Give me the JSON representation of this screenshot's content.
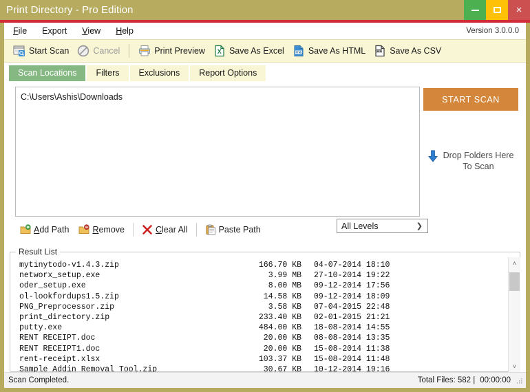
{
  "window": {
    "title": "Print Directory - Pro Edition",
    "buttons": {
      "minimize": "minimize-button",
      "maximize": "maximize-button",
      "close": "×"
    }
  },
  "menubar": {
    "items": [
      {
        "label": "File",
        "accel": "F"
      },
      {
        "label": "Export",
        "accel": ""
      },
      {
        "label": "View",
        "accel": "V"
      },
      {
        "label": "Help",
        "accel": "H"
      }
    ],
    "version": "Version 3.0.0.0"
  },
  "toolbar": {
    "buttons": [
      {
        "label": "Start Scan",
        "icon": "scan-window-icon",
        "disabled": false
      },
      {
        "label": "Cancel",
        "icon": "cancel-icon",
        "disabled": true
      },
      {
        "label": "Print Preview",
        "icon": "printer-icon",
        "disabled": false
      },
      {
        "label": "Save As Excel",
        "icon": "excel-file-icon",
        "disabled": false
      },
      {
        "label": "Save As HTML",
        "icon": "html-file-icon",
        "disabled": false
      },
      {
        "label": "Save As CSV",
        "icon": "csv-file-icon",
        "disabled": false
      }
    ]
  },
  "tabs": [
    {
      "label": "Scan Locations",
      "active": true
    },
    {
      "label": "Filters",
      "active": false
    },
    {
      "label": "Exclusions",
      "active": false
    },
    {
      "label": "Report Options",
      "active": false
    }
  ],
  "scan_locations": {
    "paths": [
      "C:\\Users\\Ashis\\Downloads"
    ],
    "path_toolbar": [
      {
        "label": "Add Path",
        "accel": "A",
        "icon": "folder-add-icon"
      },
      {
        "label": "Remove",
        "accel": "R",
        "icon": "folder-remove-icon"
      },
      {
        "label": "Clear All",
        "accel": "C",
        "icon": "red-x-icon"
      },
      {
        "label": "Paste Path",
        "accel": "",
        "icon": "clipboard-icon"
      }
    ],
    "levels": {
      "selected": "All Levels",
      "options": [
        "All Levels"
      ]
    },
    "start_scan_button": "START SCAN",
    "drop_zone": {
      "icon": "download-arrow-icon",
      "line1": "Drop Folders Here",
      "line2": "To Scan"
    }
  },
  "result_list": {
    "group_label": "Result List",
    "rows": [
      {
        "name": "mytinytodo-v1.4.3.zip",
        "size": "166.70 KB",
        "date": "04-07-2014 18:10"
      },
      {
        "name": "networx_setup.exe",
        "size": "3.99 MB",
        "date": "27-10-2014 19:22"
      },
      {
        "name": "oder_setup.exe",
        "size": "8.00 MB",
        "date": "09-12-2014 17:56"
      },
      {
        "name": "ol-lookfordups1.5.zip",
        "size": "14.58 KB",
        "date": "09-12-2014 18:09"
      },
      {
        "name": "PNG_Preprocessor.zip",
        "size": "3.58 KB",
        "date": "07-04-2015 22:48"
      },
      {
        "name": "print_directory.zip",
        "size": "233.40 KB",
        "date": "02-01-2015 21:21"
      },
      {
        "name": "putty.exe",
        "size": "484.00 KB",
        "date": "18-08-2014 14:55"
      },
      {
        "name": "RENT RECEIPT.doc",
        "size": "20.00 KB",
        "date": "08-08-2014 13:35"
      },
      {
        "name": "RENT RECEIPT1.doc",
        "size": "20.00 KB",
        "date": "15-08-2014 11:38"
      },
      {
        "name": "rent-receipt.xlsx",
        "size": "103.37 KB",
        "date": "15-08-2014 11:48"
      },
      {
        "name": "Sample Addin Removal Tool.zip",
        "size": "30.67 KB",
        "date": "10-12-2014 19:16"
      }
    ],
    "scrollbar": {
      "up": "˄",
      "down": "˅"
    }
  },
  "statusbar": {
    "message": "Scan Completed.",
    "total_files": "Total Files: 582  |",
    "elapsed": "00:00:00"
  },
  "colors": {
    "titlebar": "#b6ab5e",
    "accent_red": "#d02b36",
    "tab_active": "#85b883",
    "toolbar_bg": "#f8f6d5",
    "start_scan": "#d4873a",
    "minimize": "#4caf50",
    "maximize": "#ffc107",
    "close": "#cc5050"
  }
}
